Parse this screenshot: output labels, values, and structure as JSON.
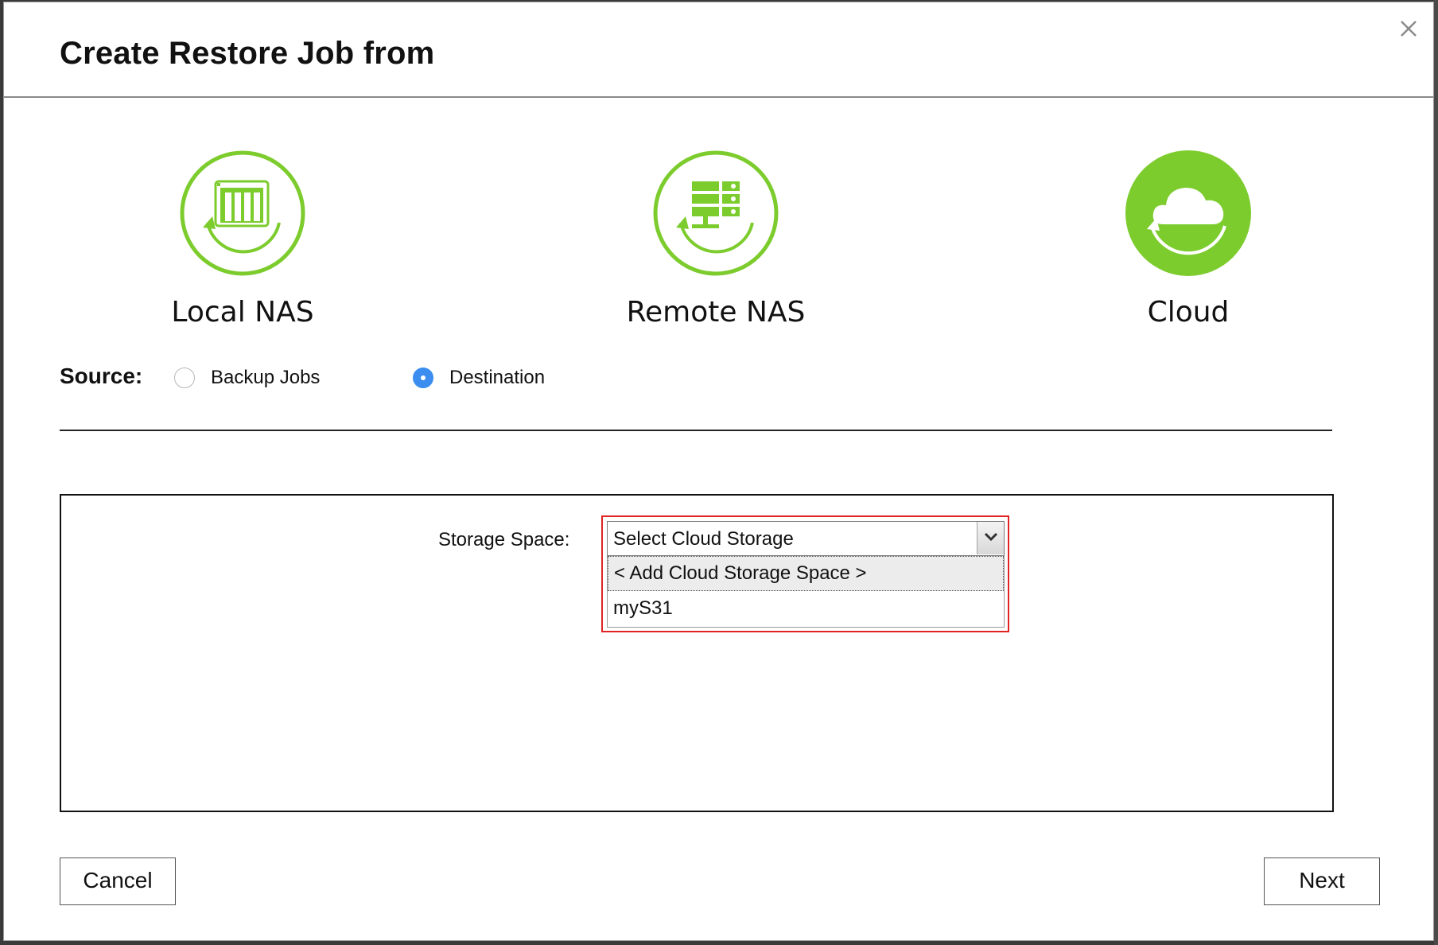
{
  "dialog": {
    "title": "Create Restore Job from"
  },
  "sources": [
    {
      "label": "Local NAS",
      "icon": "local-nas-icon",
      "selected": false
    },
    {
      "label": "Remote NAS",
      "icon": "remote-nas-icon",
      "selected": false
    },
    {
      "label": "Cloud",
      "icon": "cloud-icon",
      "selected": true
    }
  ],
  "source_row": {
    "label": "Source:",
    "options": [
      {
        "label": "Backup Jobs",
        "checked": false
      },
      {
        "label": "Destination",
        "checked": true
      }
    ]
  },
  "storage": {
    "label": "Storage Space:",
    "select_value": "Select Cloud Storage",
    "options": [
      "< Add Cloud Storage Space >",
      "myS31"
    ]
  },
  "buttons": {
    "cancel": "Cancel",
    "next": "Next"
  },
  "colors": {
    "accent_green": "#7dcc2e",
    "radio_blue": "#3b8eef",
    "highlight_red": "#e02424"
  }
}
